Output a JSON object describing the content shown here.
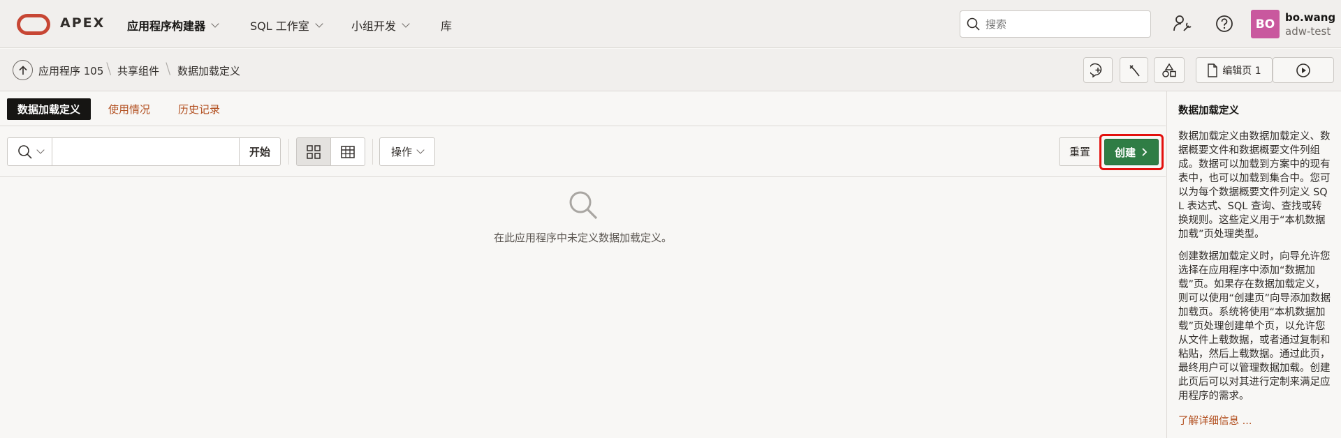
{
  "header": {
    "brand": "APEX",
    "nav": [
      {
        "label": "应用程序构建器",
        "active": true,
        "has_menu": true
      },
      {
        "label": "SQL 工作室",
        "active": false,
        "has_menu": true
      },
      {
        "label": "小组开发",
        "active": false,
        "has_menu": true
      },
      {
        "label": "库",
        "active": false,
        "has_menu": false
      }
    ],
    "search_placeholder": "搜索",
    "user": {
      "initials": "BO",
      "name": "bo.wang",
      "workspace": "adw-test"
    }
  },
  "breadcrumb": {
    "items": [
      "应用程序 105",
      "共享组件",
      "数据加载定义"
    ]
  },
  "page_toolbar": {
    "edit_page_label": "编辑页 1"
  },
  "tabs": [
    {
      "label": "数据加载定义",
      "active": true
    },
    {
      "label": "使用情况",
      "active": false
    },
    {
      "label": "历史记录",
      "active": false
    }
  ],
  "report_toolbar": {
    "search_value": "",
    "go_label": "开始",
    "actions_label": "操作",
    "reset_label": "重置",
    "create_label": "创建"
  },
  "empty_state": {
    "message": "在此应用程序中未定义数据加载定义。"
  },
  "help_panel": {
    "title": "数据加载定义",
    "paragraphs": [
      "数据加载定义由数据加载定义、数据概要文件和数据概要文件列组成。数据可以加载到方案中的现有表中，也可以加载到集合中。您可以为每个数据概要文件列定义 SQL 表达式、SQL 查询、查找或转换规则。这些定义用于“本机数据加载”页处理类型。",
      "创建数据加载定义时，向导允许您选择在应用程序中添加“数据加载”页。如果存在数据加载定义，则可以使用“创建页”向导添加数据加载页。系统将使用“本机数据加载”页处理创建单个页，以允许您从文件上载数据，或者通过复制和粘贴，然后上载数据。通过此页，最终用户可以管理数据加载。创建此页后可以对其进行定制来满足应用程序的需求。"
    ],
    "learn_more": "了解详细信息 ..."
  },
  "colors": {
    "oracle_red": "#c74634",
    "create_green": "#2f7d45",
    "highlight_red": "#e3100d",
    "link_orange": "#b24f1f",
    "avatar_pink": "#c9589e"
  }
}
